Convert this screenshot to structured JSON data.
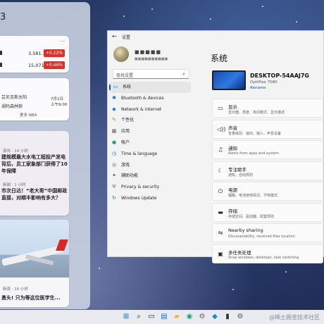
{
  "widgets": {
    "partial_number": "3",
    "stocks": {
      "more_label": "···",
      "rows": [
        {
          "value": "3,581.17",
          "change": "+0.22%"
        },
        {
          "value": "15,071.31",
          "change": "+0.46%"
        }
      ]
    },
    "nba": {
      "team1": "芸尼克斯太阳",
      "team2": "湖犸森林狼",
      "date": "7月1日",
      "time": "上午9:00",
      "more": "更多 NBA"
    },
    "news1": {
      "source": "资讯 · 14 小时",
      "title": "建规模最大水电工程投产发电背后，员工家象部门获得了10年保障"
    },
    "news2": {
      "source": "新闻 · 1 小时",
      "title": "市次日达！“老大哥”中国邮政直接，对顺丰影响有多大？"
    },
    "news3": {
      "source": "新浪 · 10 小时",
      "title": "勇头! 只为等这位医学生..."
    }
  },
  "settings": {
    "app_title": "设置",
    "back_icon": "back-arrow-icon",
    "user": {
      "name": "■■■■■",
      "email": "■■■■■■■■■■"
    },
    "search_placeholder": "查找设置",
    "nav": [
      {
        "label": "系统",
        "icon": "▭",
        "color": "#0067c0",
        "active": true
      },
      {
        "label": "Bluetooth & devices",
        "icon": "✱",
        "color": "#0a6cd6"
      },
      {
        "label": "Network & internet",
        "icon": "◆",
        "color": "#1a73c9"
      },
      {
        "label": "个性化",
        "icon": "✎",
        "color": "#c77a2e"
      },
      {
        "label": "应用",
        "icon": "▦",
        "color": "#5a5a5a"
      },
      {
        "label": "帐户",
        "icon": "●",
        "color": "#2aa37a"
      },
      {
        "label": "Time & language",
        "icon": "◷",
        "color": "#0a6cd6"
      },
      {
        "label": "游戏",
        "icon": "◎",
        "color": "#5a5a5a"
      },
      {
        "label": "辅助功能",
        "icon": "✦",
        "color": "#1f5fb0"
      },
      {
        "label": "Privacy & security",
        "icon": "⛨",
        "color": "#6b6b6b"
      },
      {
        "label": "Windows Update",
        "icon": "↻",
        "color": "#0a6cd6"
      }
    ],
    "page_title": "系统",
    "device": {
      "name": "DESKTOP-54AAJ7G",
      "model": "OptiPlex 7080",
      "rename": "Rename"
    },
    "items": [
      {
        "title": "显示",
        "desc": "显示器、亮度、夜间模式、显示描述",
        "icon": "▭"
      },
      {
        "title": "声音",
        "desc": "音量级别、输出、输入、声音设备",
        "icon": "◁))"
      },
      {
        "title": "通知",
        "desc": "Alerts from apps and system",
        "icon": "♫"
      },
      {
        "title": "专注助手",
        "desc": "通知，自动规则",
        "icon": "☾"
      },
      {
        "title": "电源",
        "desc": "睡眠、电池使用情况、节电模式",
        "icon": "⏻"
      },
      {
        "title": "存储",
        "desc": "存储空间、驱动器、配置规则",
        "icon": "▬"
      },
      {
        "title": "Nearby sharing",
        "desc": "Discoverability, received files location",
        "icon": "⇋"
      },
      {
        "title": "多任务处理",
        "desc": "Snap windows, desktops, task switching",
        "icon": "▣"
      }
    ]
  },
  "taskbar": {
    "icons": [
      {
        "name": "start-icon",
        "glyph": "⊞",
        "color": "#0a6cd6"
      },
      {
        "name": "search-icon",
        "glyph": "⌕",
        "color": "#222"
      },
      {
        "name": "task-view-icon",
        "glyph": "▭",
        "color": "#222"
      },
      {
        "name": "widgets-icon",
        "glyph": "▤",
        "color": "#1a73c9"
      },
      {
        "name": "file-explorer-icon",
        "glyph": "▰",
        "color": "#e8b33a"
      },
      {
        "name": "chrome-icon",
        "glyph": "◉",
        "color": "#1da462"
      },
      {
        "name": "settings-icon",
        "glyph": "⚙",
        "color": "#666"
      },
      {
        "name": "vscode-icon",
        "glyph": "◆",
        "color": "#1a8ad4"
      },
      {
        "name": "terminal-icon",
        "glyph": "▮",
        "color": "#333"
      },
      {
        "name": "gear-active-icon",
        "glyph": "⚙",
        "color": "#555"
      }
    ],
    "watermark": "@稀土掘金技术社区"
  }
}
